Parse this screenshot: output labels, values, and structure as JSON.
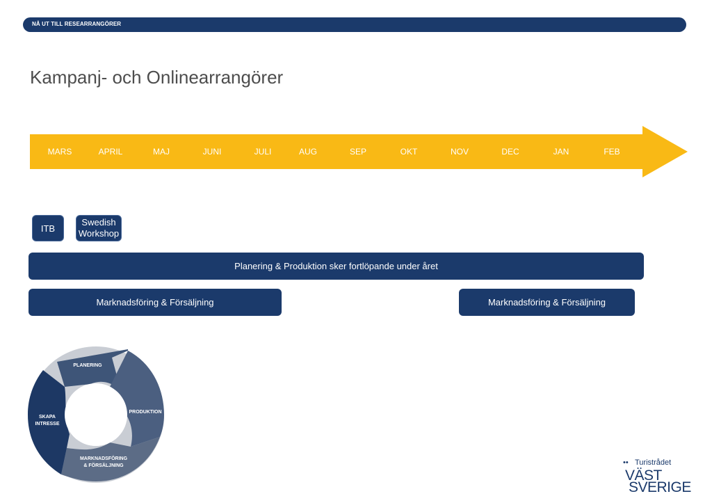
{
  "header": {
    "banner_text": "NÅ UT TILL RESEARRANGÖRER"
  },
  "page": {
    "title": "Kampanj- och Onlinearrangörer"
  },
  "timeline": {
    "months": [
      "MARS",
      "APRIL",
      "MAJ",
      "JUNI",
      "JULI",
      "AUG",
      "SEP",
      "OKT",
      "NOV",
      "DEC",
      "JAN",
      "FEB"
    ]
  },
  "events": {
    "itb": "ITB",
    "swedish_workshop": "Swedish Workshop"
  },
  "bars": {
    "planning": "Planering & Produktion sker fortlöpande under året",
    "marketing_1": "Marknadsföring & Försäljning",
    "marketing_2": "Marknadsföring & Försäljning"
  },
  "cycle": {
    "planering": "PLANERING",
    "produktion": "PRODUKTION",
    "marknadsforing": "MARKNADSFÖRING\n& FÖRSÄLJNING",
    "skapa_intresse": "SKAPA\nINTRESSE"
  },
  "logo": {
    "small": "Turistrådet",
    "line1": "VÄST",
    "line2": "SVERIGE"
  },
  "colors": {
    "navy": "#1b3a6b",
    "timeline_yellow": "#f9b915",
    "cycle_dark": "#1d3864",
    "cycle_mid": "#3e5578",
    "cycle_light": "#5a6a85"
  }
}
